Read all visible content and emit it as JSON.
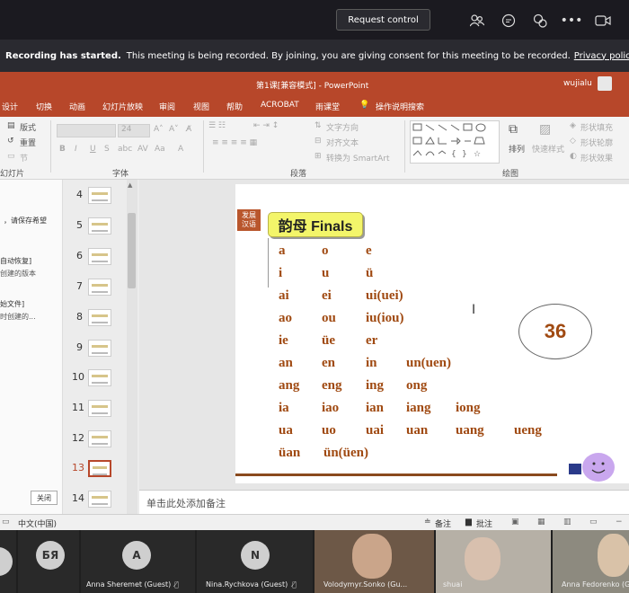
{
  "teams": {
    "request_control": "Request control",
    "recording_title": "Recording has started.",
    "recording_text": "This meeting is being recorded. By joining, you are giving consent for this meeting to be recorded.",
    "privacy_link": "Privacy policy"
  },
  "ppt": {
    "doc_title": "第1课[兼容模式] - PowerPoint",
    "user": "wujialu",
    "tabs": [
      "设计",
      "切换",
      "动画",
      "幻灯片放映",
      "审阅",
      "视图",
      "帮助",
      "ACROBAT",
      "雨课堂",
      "操作说明搜索"
    ],
    "ribbon": {
      "layout": "版式",
      "reset": "重置",
      "section": "节",
      "slides_group": "幻灯片",
      "font_size": "24",
      "font_group": "字体",
      "text_direction": "文字方向",
      "align_text": "对齐文本",
      "smartart": "转换为 SmartArt",
      "paragraph_group": "段落",
      "arrange": "排列",
      "quick_styles": "快速样式",
      "shape_fill": "形状填充",
      "shape_outline": "形状轮廓",
      "shape_effects": "形状效果",
      "drawing_group": "绘图"
    }
  },
  "left_panel": {
    "line1": "，请保存希望",
    "line2": "自动恢复]",
    "line3": "创建的版本",
    "line4": "始文件]",
    "line5": "时创建的...",
    "close": "关闭"
  },
  "thumbnails": [
    "4",
    "5",
    "6",
    "7",
    "8",
    "9",
    "10",
    "11",
    "12",
    "13",
    "14"
  ],
  "slide": {
    "badge_line1": "发展",
    "badge_line2": "汉语",
    "title": "韵母 Finals",
    "rows": [
      [
        "a",
        "o",
        "e"
      ],
      [
        "i",
        "u",
        "ü"
      ],
      [
        "ai",
        "ei",
        "ui(uei)"
      ],
      [
        "ao",
        "ou",
        "iu(iou)"
      ],
      [
        "ie",
        "üe",
        "er"
      ],
      [
        "an",
        "en",
        "in",
        "un(uen)"
      ],
      [
        "ang",
        "eng",
        "ing",
        "ong"
      ],
      [
        "ia",
        "iao",
        "ian",
        "iang",
        "iong"
      ],
      [
        "ua",
        "uo",
        "uai",
        "uan",
        "uang",
        "ueng"
      ],
      [
        "üan",
        "ün(üen)"
      ]
    ],
    "page_number": "36"
  },
  "notes_placeholder": "单击此处添加备注",
  "status": {
    "language": "中文(中国)",
    "notes": "备注",
    "comments": "批注"
  },
  "participants": [
    {
      "initials": "БЯ",
      "name": ""
    },
    {
      "initials": "A",
      "name": "Anna Sheremet (Guest)"
    },
    {
      "initials": "N",
      "name": "Nina.Rychkova (Guest)"
    },
    {
      "initials": "",
      "name": "Volodymyr.Sonko (Gu..."
    },
    {
      "initials": "",
      "name": "shuai"
    },
    {
      "initials": "",
      "name": "Anna Fedorenko (G..."
    }
  ],
  "colors": {
    "ppt_brand": "#b7472a",
    "final_text": "#a04a12",
    "title_bg": "#f3f56a"
  }
}
